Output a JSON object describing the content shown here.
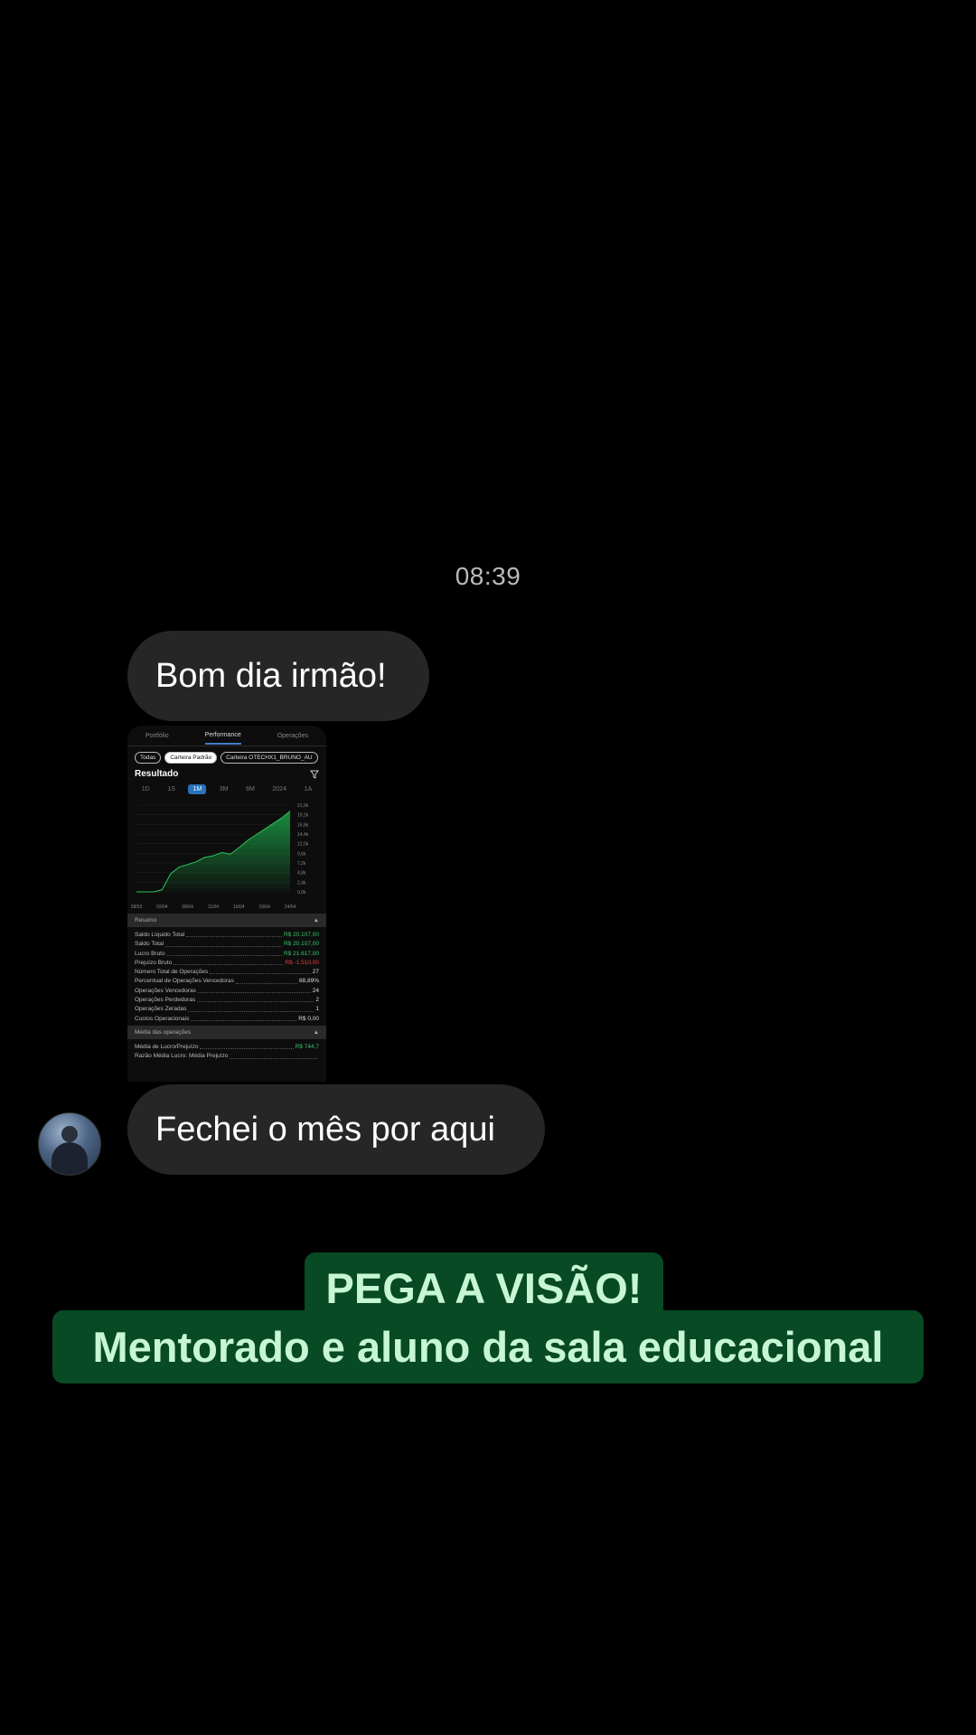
{
  "chat": {
    "timestamp": "08:39",
    "messages": [
      {
        "text": "Bom dia irmão!"
      },
      {
        "text": "Fechei o mês por aqui"
      }
    ]
  },
  "embedded_screenshot": {
    "tabs": [
      "Portfólio",
      "Performance",
      "Operações"
    ],
    "active_tab": "Performance",
    "chips": [
      "Todas",
      "Carteira Padrão",
      "Carteira OTECHX1_BRUNO_AU"
    ],
    "selected_chip": "Carteira Padrão",
    "result_title": "Resultado",
    "periods": [
      "1D",
      "1S",
      "1M",
      "3M",
      "6M",
      "2024",
      "1A"
    ],
    "selected_period": "1M",
    "accent_color": "#2a72b9",
    "chart_data": {
      "type": "area",
      "x": [
        "28/03",
        "02/04",
        "08/04",
        "11/04",
        "16/04",
        "19/04",
        "24/04"
      ],
      "y_ticks": [
        "0,0k",
        "2,4k",
        "4,8k",
        "7,2k",
        "9,6k",
        "12,0k",
        "14,4k",
        "16,8k",
        "19,2k",
        "21,6k"
      ],
      "values_k": [
        0,
        0,
        0,
        0.5,
        4.5,
        6.2,
        6.8,
        7.5,
        8.6,
        9.0,
        9.8,
        9.4,
        11.0,
        12.8,
        14.2,
        15.6,
        17.0,
        18.4,
        20.1
      ],
      "ylim": [
        0,
        21.6
      ],
      "color": "#1a8c3e"
    },
    "resumo": {
      "label": "Resumo",
      "rows": [
        {
          "label": "Saldo Líquido Total",
          "value": "R$ 20.107,00",
          "color": "green"
        },
        {
          "label": "Saldo Total",
          "value": "R$ 20.107,00",
          "color": "green"
        },
        {
          "label": "Lucro Bruto",
          "value": "R$ 21.617,00",
          "color": "green"
        },
        {
          "label": "Prejuízo Bruto",
          "value": "R$ -1.510,00",
          "color": "red"
        },
        {
          "label": "Número Total de Operações",
          "value": "27",
          "color": "white"
        },
        {
          "label": "Percentual de Operações Vencedoras",
          "value": "88,89%",
          "color": "white"
        },
        {
          "label": "Operações Vencedoras",
          "value": "24",
          "color": "white"
        },
        {
          "label": "Operações Perdedoras",
          "value": "2",
          "color": "white"
        },
        {
          "label": "Operações Zeradas",
          "value": "1",
          "color": "white"
        },
        {
          "label": "Custos Operacionais",
          "value": "R$ 0,00",
          "color": "white"
        }
      ]
    },
    "media": {
      "label": "Média das operações",
      "rows": [
        {
          "label": "Média de Lucro/Prejuízo",
          "value": "R$ 744,7",
          "color": "green"
        },
        {
          "label": "Razão Média Lucro: Média Prejuízo",
          "value": "",
          "color": "white"
        }
      ]
    }
  },
  "caption": {
    "line1": "PEGA A VISÃO!",
    "line2": "Mentorado e aluno da sala educacional",
    "bg_color": "#074a24",
    "text_color": "#c6f6d2"
  }
}
